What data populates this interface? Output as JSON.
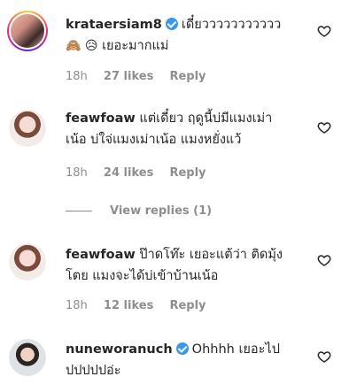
{
  "comments": [
    {
      "username": "krataersiam8",
      "verified": true,
      "text_line1": "เดี๋ยววววววววววว",
      "emoji_line2": "🙈 😥",
      "text_line2": "เยอะมากแม่",
      "time": "18h",
      "likes": "27 likes",
      "reply": "Reply"
    },
    {
      "username": "feawfoaw",
      "verified": false,
      "text_line1": "แต่เดี๋ยว ฤดูนี้บ่มีแมงเม่า",
      "text_line2": "เน้อ บ่ใจ่แมงเม่าเน้อ แมงหยั่งแว้",
      "time": "18h",
      "likes": "24 likes",
      "reply": "Reply"
    },
    {
      "username": "feawfoaw",
      "verified": false,
      "text_line1": "ป๊าดโท๊ะ เยอะแต้ว่า ติดมุ้ง",
      "text_line2": "โตย แมงจะได้บ่เข้าบ้านเน้อ",
      "time": "18h",
      "likes": "12 likes",
      "reply": "Reply"
    },
    {
      "username": "nuneworanuch",
      "verified": true,
      "text_line1": "Ohhhh เยอะไป",
      "text_line2": "ปปปปปอ่ะ"
    }
  ],
  "view_replies": "View replies (1)",
  "colors": {
    "text": "#262626",
    "muted": "#8e8e8e",
    "verified": "#3897f0"
  }
}
